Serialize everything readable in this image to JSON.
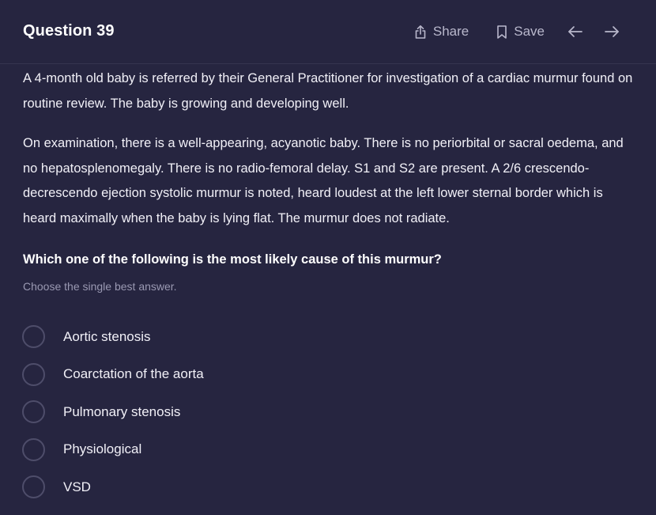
{
  "header": {
    "title": "Question 39",
    "share_label": "Share",
    "save_label": "Save"
  },
  "icons": {
    "share": "share-icon",
    "save": "bookmark-icon",
    "prev": "arrow-left-icon",
    "next": "arrow-right-icon"
  },
  "stem": {
    "para1": "A 4-month old baby is referred by their General Practitioner for investigation of a cardiac murmur found on routine review. The baby is growing and developing well.",
    "para2": "On examination, there is a well-appearing, acyanotic baby. There is no periorbital or sacral oedema, and no hepatosplenomegaly. There is no radio-femoral delay. S1 and S2 are present. A 2/6 crescendo-decrescendo ejection systolic murmur is noted, heard loudest at the left lower sternal border which is heard maximally when the baby is lying flat. The murmur does not radiate."
  },
  "question": {
    "prompt": "Which one of the following is the most likely cause of this murmur?",
    "hint": "Choose the single best answer."
  },
  "options": [
    {
      "label": "Aortic stenosis"
    },
    {
      "label": "Coarctation of the aorta"
    },
    {
      "label": "Pulmonary stenosis"
    },
    {
      "label": "Physiological"
    },
    {
      "label": "VSD"
    }
  ],
  "colors": {
    "background": "#262540",
    "text": "#f1f0f7",
    "muted": "#9a99b2",
    "radio_border": "#4e4d6a"
  }
}
